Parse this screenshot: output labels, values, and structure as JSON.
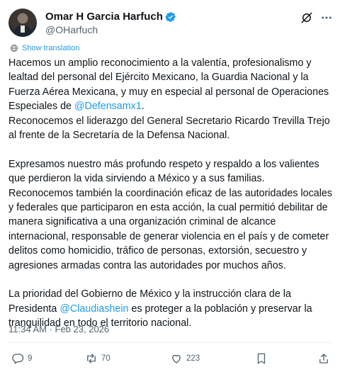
{
  "author": {
    "name": "Omar H Garcia Harfuch",
    "handle": "@OHarfuch",
    "verified": true
  },
  "translate": {
    "label": "Show translation"
  },
  "tweet": {
    "p1_a": "Hacemos un amplio reconocimiento a la valentía, profesionalismo y lealtad del personal del Ejército Mexicano, la Guardia Nacional y la Fuerza Aérea Mexicana, y muy en especial al personal de Operaciones Especiales de ",
    "p1_mention": "@Defensamx1",
    "p1_b": ".",
    "p2": "Reconocemos el liderazgo del General Secretario Ricardo Trevilla Trejo al frente de la Secretaría de la Defensa Nacional.",
    "p3": "Expresamos nuestro más profundo respeto y respaldo a los valientes que perdieron la vida sirviendo a México y a sus familias.",
    "p4": "Reconocemos también la coordinación eficaz de las autoridades locales y federales que participaron en esta acción, la cual permitió debilitar de manera significativa a una organización criminal de alcance internacional, responsable de generar violencia en el país y de cometer delitos como homicidio, tráfico de personas, extorsión, secuestro y agresiones armadas contra las autoridades por muchos años.",
    "p5_a": "La prioridad del Gobierno de México y la instrucción clara de la Presidenta ",
    "p5_mention": "@Claudiashein",
    "p5_b": " es proteger a la población y preservar la tranquilidad en todo el territorio nacional."
  },
  "timestamp": "11:34 AM · Feb 23, 2026",
  "actions": {
    "replies": "9",
    "reposts": "70",
    "likes": "223",
    "bookmarks": "",
    "share": ""
  },
  "colors": {
    "accent": "#1d9bf0",
    "text": "#0f1419",
    "muted": "#536471",
    "divider": "#eff3f4"
  },
  "icons": {
    "verified": "verified-badge-icon",
    "grok": "grok-icon",
    "more": "more-dots-icon",
    "translate": "translate-globe-icon",
    "reply": "reply-bubble-icon",
    "repost": "repost-arrows-icon",
    "like": "heart-icon",
    "bookmark": "bookmark-icon",
    "share": "share-upload-icon"
  }
}
